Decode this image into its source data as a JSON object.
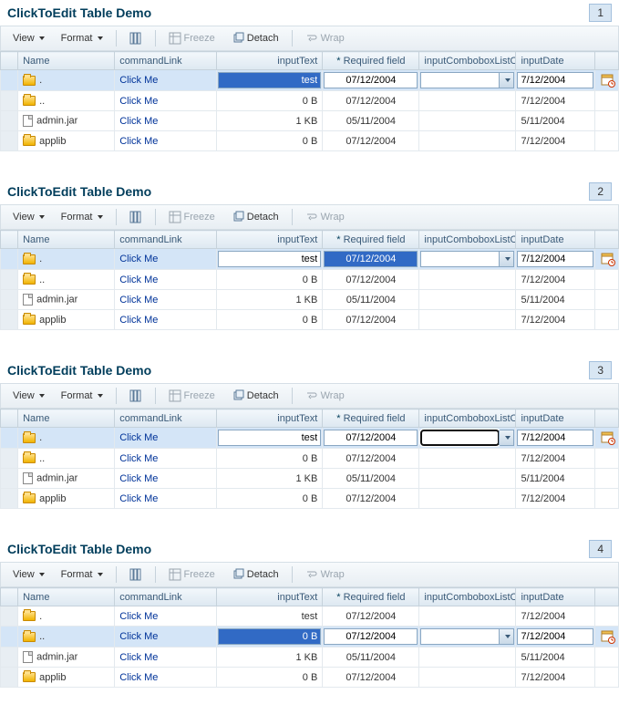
{
  "panels": [
    {
      "number": "1",
      "title": "ClickToEdit Table Demo",
      "toolbar": {
        "view": "View",
        "format": "Format",
        "freeze": "Freeze",
        "detach": "Detach",
        "wrap": "Wrap"
      },
      "headers": {
        "name": "Name",
        "commandLink": "commandLink",
        "inputText": "inputText",
        "required": "Required field",
        "combo": "inputComboboxListOf",
        "date": "inputDate"
      },
      "rows": [
        {
          "selected": true,
          "icon": "folder",
          "name": ".",
          "cmd": "Click Me",
          "inputText": "test",
          "inputTextHighlight": true,
          "req": "07/12/2004",
          "combo": "",
          "date": "7/12/2004",
          "editable": true
        },
        {
          "icon": "folder",
          "name": "..",
          "cmd": "Click Me",
          "inputText": "0 B",
          "req": "07/12/2004",
          "combo": "",
          "date": "7/12/2004"
        },
        {
          "icon": "file",
          "name": "admin.jar",
          "cmd": "Click Me",
          "inputText": "1 KB",
          "req": "05/11/2004",
          "combo": "",
          "date": "5/11/2004"
        },
        {
          "icon": "folder",
          "name": "applib",
          "cmd": "Click Me",
          "inputText": "0 B",
          "req": "07/12/2004",
          "combo": "",
          "date": "7/12/2004"
        }
      ]
    },
    {
      "number": "2",
      "title": "ClickToEdit Table Demo",
      "toolbar": {
        "view": "View",
        "format": "Format",
        "freeze": "Freeze",
        "detach": "Detach",
        "wrap": "Wrap"
      },
      "headers": {
        "name": "Name",
        "commandLink": "commandLink",
        "inputText": "inputText",
        "required": "Required field",
        "combo": "inputComboboxListOf",
        "date": "inputDate"
      },
      "rows": [
        {
          "selected": true,
          "icon": "folder",
          "name": ".",
          "cmd": "Click Me",
          "inputText": "test",
          "req": "07/12/2004",
          "reqHighlight": true,
          "combo": "",
          "date": "7/12/2004",
          "editable": true
        },
        {
          "icon": "folder",
          "name": "..",
          "cmd": "Click Me",
          "inputText": "0 B",
          "req": "07/12/2004",
          "combo": "",
          "date": "7/12/2004"
        },
        {
          "icon": "file",
          "name": "admin.jar",
          "cmd": "Click Me",
          "inputText": "1 KB",
          "req": "05/11/2004",
          "combo": "",
          "date": "5/11/2004"
        },
        {
          "icon": "folder",
          "name": "applib",
          "cmd": "Click Me",
          "inputText": "0 B",
          "req": "07/12/2004",
          "combo": "",
          "date": "7/12/2004"
        }
      ]
    },
    {
      "number": "3",
      "title": "ClickToEdit Table Demo",
      "toolbar": {
        "view": "View",
        "format": "Format",
        "freeze": "Freeze",
        "detach": "Detach",
        "wrap": "Wrap"
      },
      "headers": {
        "name": "Name",
        "commandLink": "commandLink",
        "inputText": "inputText",
        "required": "Required field",
        "combo": "inputComboboxListOf",
        "date": "inputDate"
      },
      "rows": [
        {
          "selected": true,
          "icon": "folder",
          "name": ".",
          "cmd": "Click Me",
          "inputText": "test",
          "req": "07/12/2004",
          "combo": "",
          "comboFocus": true,
          "date": "7/12/2004",
          "editable": true
        },
        {
          "icon": "folder",
          "name": "..",
          "cmd": "Click Me",
          "inputText": "0 B",
          "req": "07/12/2004",
          "combo": "",
          "date": "7/12/2004"
        },
        {
          "icon": "file",
          "name": "admin.jar",
          "cmd": "Click Me",
          "inputText": "1 KB",
          "req": "05/11/2004",
          "combo": "",
          "date": "5/11/2004"
        },
        {
          "icon": "folder",
          "name": "applib",
          "cmd": "Click Me",
          "inputText": "0 B",
          "req": "07/12/2004",
          "combo": "",
          "date": "7/12/2004"
        }
      ]
    },
    {
      "number": "4",
      "title": "ClickToEdit Table Demo",
      "toolbar": {
        "view": "View",
        "format": "Format",
        "freeze": "Freeze",
        "detach": "Detach",
        "wrap": "Wrap"
      },
      "headers": {
        "name": "Name",
        "commandLink": "commandLink",
        "inputText": "inputText",
        "required": "Required field",
        "combo": "inputComboboxListOf",
        "date": "inputDate"
      },
      "rows": [
        {
          "icon": "folder",
          "name": ".",
          "cmd": "Click Me",
          "inputText": "test",
          "req": "07/12/2004",
          "combo": "",
          "date": "7/12/2004"
        },
        {
          "selected": true,
          "icon": "folder",
          "name": "..",
          "cmd": "Click Me",
          "inputText": "0 B",
          "inputTextHighlight": true,
          "req": "07/12/2004",
          "combo": "",
          "date": "7/12/2004",
          "editable": true
        },
        {
          "icon": "file",
          "name": "admin.jar",
          "cmd": "Click Me",
          "inputText": "1 KB",
          "req": "05/11/2004",
          "combo": "",
          "date": "5/11/2004"
        },
        {
          "icon": "folder",
          "name": "applib",
          "cmd": "Click Me",
          "inputText": "0 B",
          "req": "07/12/2004",
          "combo": "",
          "date": "7/12/2004"
        }
      ]
    }
  ]
}
